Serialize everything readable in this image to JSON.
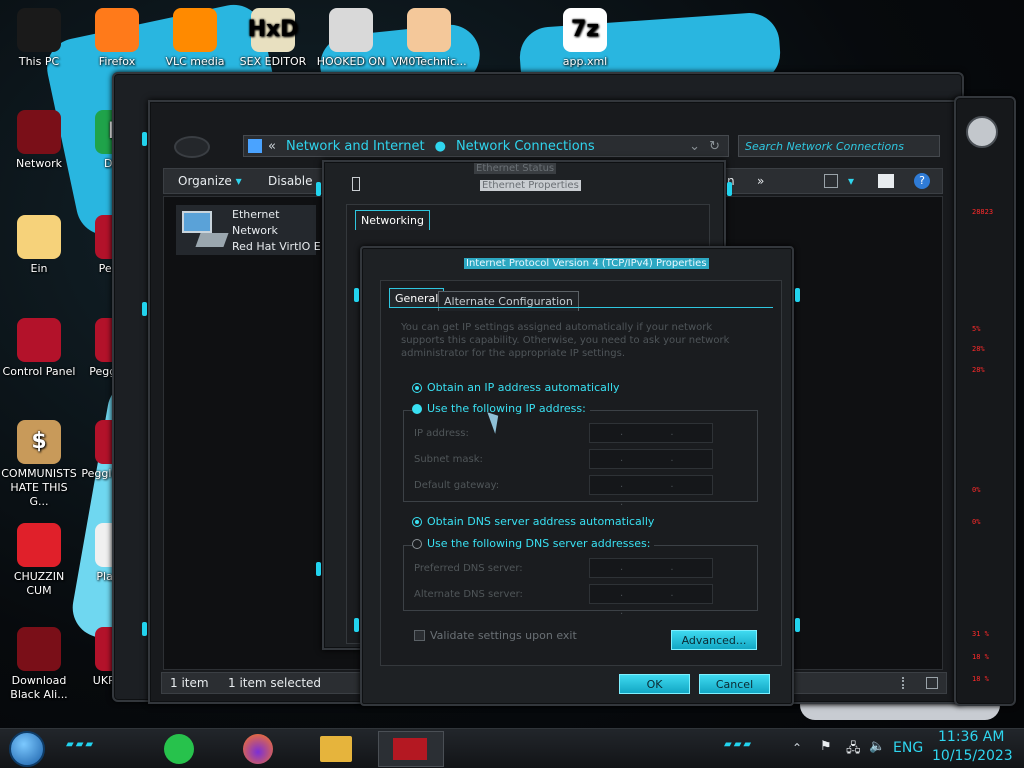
{
  "desktop": {
    "icons": [
      {
        "label": "This PC",
        "icon": "computer-icon"
      },
      {
        "label": "Firefox",
        "icon": "firefox-icon"
      },
      {
        "label": "VLC media",
        "icon": "vlc-cone-icon"
      },
      {
        "label": "SEX EDITOR",
        "icon": "hxd-icon",
        "glyph_text": "HxD"
      },
      {
        "label": "HOOKED ON",
        "icon": "hooked-icon"
      },
      {
        "label": "VM0Technic...",
        "icon": "doctor-icon"
      },
      {
        "label": "app.xml",
        "icon": "7zip-icon",
        "glyph_text": "7z"
      },
      {
        "label": "Network",
        "icon": "network-globe-icon"
      },
      {
        "label": "DUM",
        "icon": "dum-icon",
        "glyph_text": "D"
      },
      {
        "label": "Ein",
        "icon": "cartoon-icon"
      },
      {
        "label": "Peggle",
        "icon": "peggle-icon"
      },
      {
        "label": "Control Panel",
        "icon": "control-panel-icon"
      },
      {
        "label": "Peggle De",
        "icon": "peggle-icon"
      },
      {
        "label": "COMMUNISTS HATE THIS G...",
        "icon": "money-bag-icon",
        "glyph_text": "$"
      },
      {
        "label": "Peggle of Wa",
        "icon": "peggle-icon"
      },
      {
        "label": "CHUZZIN CUM",
        "icon": "chuzzle-icon"
      },
      {
        "label": "Plan Zo",
        "icon": "plants-icon"
      },
      {
        "label": "Download Black Ali...",
        "icon": "alien-globe-icon"
      },
      {
        "label": "UKRAINE",
        "icon": "ukraine-icon"
      }
    ]
  },
  "explorer": {
    "breadcrumb_back": "«",
    "breadcrumb": [
      "Network and Internet",
      "Network Connections"
    ],
    "search_placeholder": "Search Network Connections",
    "toolbar": {
      "organize": "Organize",
      "disable": "Disable",
      "partial": "n",
      "more": "»"
    },
    "item": {
      "name": "Ethernet",
      "line2": "Network",
      "line3": "Red Hat VirtIO E"
    },
    "status": {
      "count": "1 item",
      "selected": "1 item selected"
    }
  },
  "ethernet_props": {
    "title": "Ethernet Properties",
    "tab": "Networking",
    "ghost_title": "Ethernet Status"
  },
  "ipv4_dialog": {
    "title": "Internet Protocol Version 4 (TCP/IPv4) Properties",
    "tabs": [
      "General",
      "Alternate Configuration"
    ],
    "description": "You can get IP settings assigned automatically if your network supports this capability. Otherwise, you need to ask your network administrator for the appropriate IP settings.",
    "ip_auto_label": "Obtain an IP address automatically",
    "ip_manual_label": "Use the following IP address:",
    "ip_address_label": "IP address:",
    "subnet_label": "Subnet mask:",
    "gateway_label": "Default gateway:",
    "dns_auto_label": "Obtain DNS server address automatically",
    "dns_manual_label": "Use the following DNS server addresses:",
    "preferred_dns_label": "Preferred DNS server:",
    "alternate_dns_label": "Alternate DNS server:",
    "ip_placeholder": ". . .",
    "validate_label": "Validate settings upon exit",
    "advanced_label": "Advanced...",
    "ok_label": "OK",
    "cancel_label": "Cancel"
  },
  "sidebar_readouts": [
    "28823",
    "5%",
    "28%",
    "28%",
    "0%",
    "0%",
    "31 %",
    "18 %",
    "18 %"
  ],
  "taskbar": {
    "language": "ENG",
    "time": "11:36 AM",
    "date": "10/15/2023"
  },
  "colors": {
    "accent": "#22d3ee",
    "frame": "#1c1f23",
    "readout_red": "#ff2a2a"
  }
}
